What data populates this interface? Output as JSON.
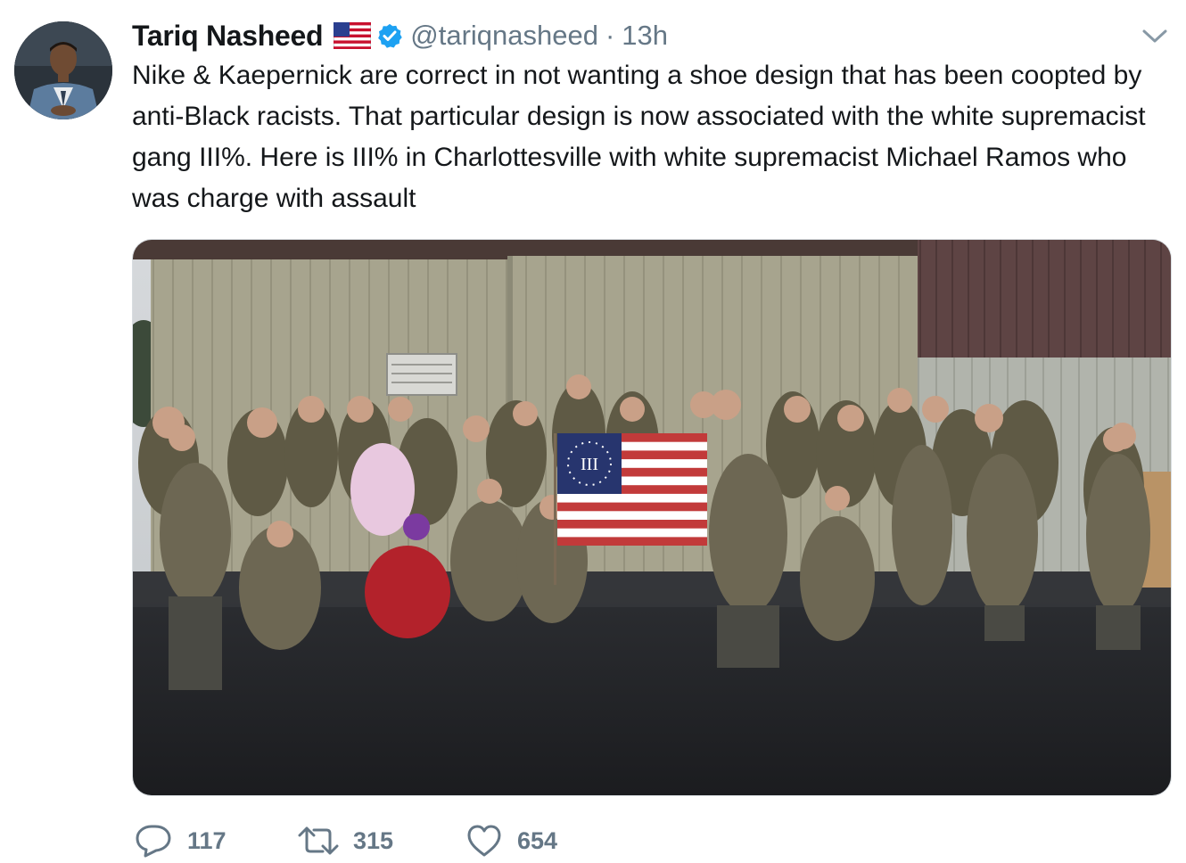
{
  "tweet": {
    "author": {
      "display_name": "Tariq Nasheed",
      "handle": "@tariqnasheed",
      "verified": true,
      "name_emoji": "us-flag-emoji",
      "avatar": "author-avatar"
    },
    "separator": "·",
    "timestamp": "13h",
    "menu_icon": "chevron-down-icon",
    "text": "Nike & Kaepernick are correct in not wanting a shoe design that has been coopted by anti-Black racists. That particular design is now associated with the white supremacist gang III%. Here is III% in Charlottesville with white supremacist Michael Ramos who was charge with assault",
    "media": {
      "type": "photo",
      "flag_symbol": "III"
    },
    "actions": {
      "reply": {
        "icon": "reply-icon",
        "count": "117"
      },
      "retweet": {
        "icon": "retweet-icon",
        "count": "315"
      },
      "like": {
        "icon": "heart-icon",
        "count": "654"
      }
    }
  },
  "colors": {
    "text_primary": "#14171a",
    "text_secondary": "#657786",
    "verified_blue": "#1da1f2",
    "background": "#ffffff"
  }
}
